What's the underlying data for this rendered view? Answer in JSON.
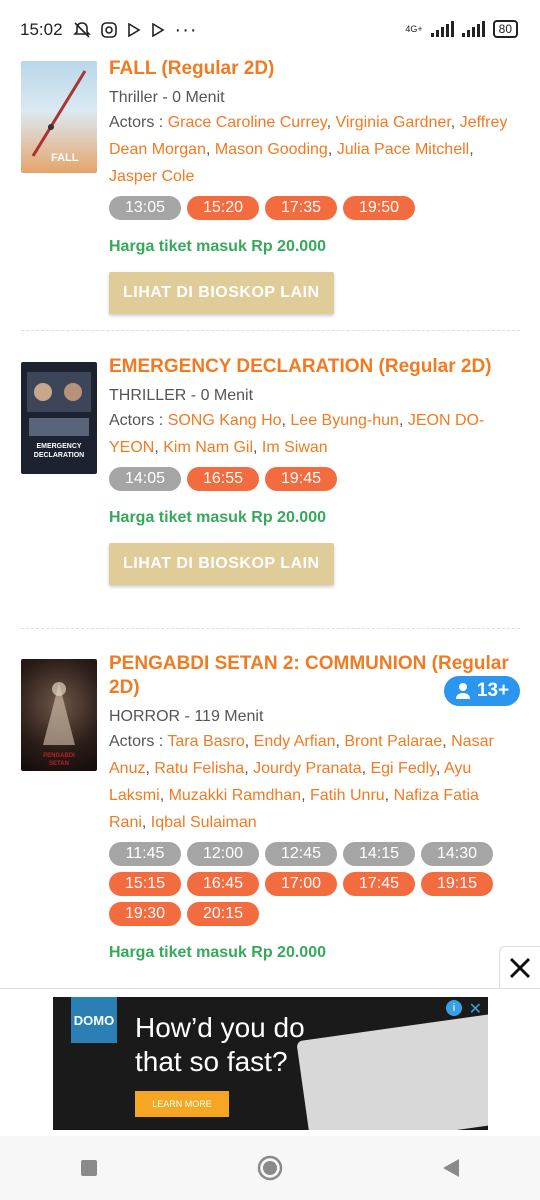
{
  "status_bar": {
    "time": "15:02",
    "network": "4G+",
    "battery": "80"
  },
  "movies": [
    {
      "title": "FALL (Regular 2D)",
      "genre_duration": "Thriller - 0 Menit",
      "actors_label": "Actors : ",
      "actors": [
        "Grace Caroline Currey",
        "Virginia Gardner",
        "Jeffrey Dean Morgan",
        "Mason Gooding",
        "Julia Pace Mitchell",
        "Jasper Cole"
      ],
      "showtimes": [
        {
          "time": "13:05",
          "status": "grey"
        },
        {
          "time": "15:20",
          "status": "orange"
        },
        {
          "time": "17:35",
          "status": "orange"
        },
        {
          "time": "19:50",
          "status": "orange"
        }
      ],
      "price": "Harga tiket masuk Rp 20.000",
      "button": "LIHAT DI BIOSKOP LAIN",
      "poster_text": "FALL"
    },
    {
      "title": "EMERGENCY DECLARATION (Regular 2D)",
      "genre_duration": "THRILLER - 0 Menit",
      "actors_label": "Actors : ",
      "actors": [
        "SONG Kang Ho",
        "Lee Byung-hun",
        "JEON DO-YEON",
        "Kim Nam Gil",
        "Im Siwan"
      ],
      "showtimes": [
        {
          "time": "14:05",
          "status": "grey"
        },
        {
          "time": "16:55",
          "status": "orange"
        },
        {
          "time": "19:45",
          "status": "orange"
        }
      ],
      "price": "Harga tiket masuk Rp 20.000",
      "button": "LIHAT DI BIOSKOP LAIN",
      "poster_text": "EMERGENCY DECLARATION"
    },
    {
      "title": "PENGABDI SETAN 2: COMMUNION (Regular 2D)",
      "genre_duration": "HORROR - 119 Menit",
      "age_rating": "13+",
      "actors_label": "Actors : ",
      "actors": [
        "Tara Basro",
        "Endy Arfian",
        "Bront Palarae",
        "Nasar Anuz",
        "Ratu Felisha",
        "Jourdy Pranata",
        "Egi Fedly",
        "Ayu Laksmi",
        "Muzakki Ramdhan",
        "Fatih Unru",
        "Nafiza Fatia Rani",
        "Iqbal Sulaiman"
      ],
      "showtimes": [
        {
          "time": "11:45",
          "status": "grey"
        },
        {
          "time": "12:00",
          "status": "grey"
        },
        {
          "time": "12:45",
          "status": "grey"
        },
        {
          "time": "14:15",
          "status": "grey"
        },
        {
          "time": "14:30",
          "status": "grey"
        },
        {
          "time": "15:15",
          "status": "orange"
        },
        {
          "time": "16:45",
          "status": "orange"
        },
        {
          "time": "17:00",
          "status": "orange"
        },
        {
          "time": "17:45",
          "status": "orange"
        },
        {
          "time": "19:15",
          "status": "orange"
        },
        {
          "time": "19:30",
          "status": "orange"
        },
        {
          "time": "20:15",
          "status": "orange"
        }
      ],
      "price": "Harga tiket masuk Rp 20.000",
      "poster_text": "PENGABDI SETAN"
    }
  ],
  "ad": {
    "logo": "DOMO",
    "headline_1": "How’d you do",
    "headline_2": "that so fast?",
    "cta": "LEARN MORE"
  },
  "colors": {
    "accent_orange": "#f27a21",
    "chip_orange": "#f26c3f",
    "chip_grey": "#a5a5a5",
    "price_green": "#36a95a",
    "button_tan": "#dfcc99",
    "age_badge_blue": "#2b96f0"
  }
}
